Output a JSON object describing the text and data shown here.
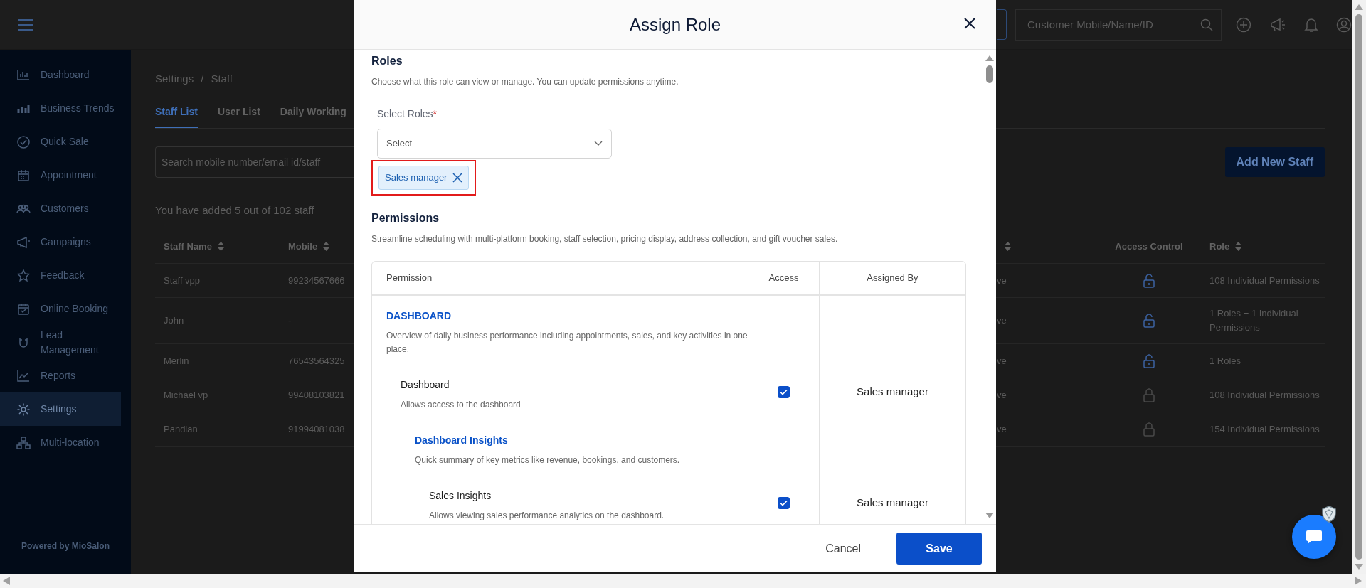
{
  "app_header": {
    "search_placeholder": "Customer Mobile/Name/ID"
  },
  "sidebar": {
    "items": [
      {
        "label": "Dashboard",
        "selected": false
      },
      {
        "label": "Business Trends",
        "selected": false
      },
      {
        "label": "Quick Sale",
        "selected": false
      },
      {
        "label": "Appointment",
        "selected": false
      },
      {
        "label": "Customers",
        "selected": false
      },
      {
        "label": "Campaigns",
        "selected": false
      },
      {
        "label": "Feedback",
        "selected": false
      },
      {
        "label": "Online Booking",
        "selected": false
      },
      {
        "label": "Lead Management",
        "selected": false
      },
      {
        "label": "Reports",
        "selected": false
      },
      {
        "label": "Settings",
        "selected": true
      },
      {
        "label": "Multi-location",
        "selected": false
      }
    ],
    "footer": "Powered by MioSalon"
  },
  "breadcrumb": {
    "items": [
      "Settings",
      "Staff"
    ],
    "separator": "/"
  },
  "tabs": [
    {
      "label": "Staff List",
      "selected": true
    },
    {
      "label": "User List",
      "selected": false
    },
    {
      "label": "Daily Working",
      "selected": false
    }
  ],
  "search": {
    "placeholder": "Search mobile number/email id/staff"
  },
  "add_button": "Add New Staff",
  "staff_summary": "You have added 5 out of 102 staff",
  "staff_table": {
    "columns": [
      {
        "label": "Staff Name",
        "sortable": true
      },
      {
        "label": "Mobile",
        "sortable": true
      },
      {
        "sortable": true
      },
      {
        "label": "Access Control",
        "sortable": false
      },
      {
        "label": "Role",
        "sortable": true
      }
    ],
    "rows": [
      {
        "staff_name": "Staff vpp",
        "mobile": "99234567666",
        "column_3": "ve",
        "access_enabled": true,
        "role": "108 Individual Permissions"
      },
      {
        "staff_name": "John",
        "mobile": "-",
        "column_3": "ve",
        "access_enabled": true,
        "role": "1 Roles + 1 Individual Permissions"
      },
      {
        "staff_name": "Merlin",
        "mobile": "76543564325",
        "column_3": "ve",
        "access_enabled": true,
        "role": "1 Roles"
      },
      {
        "staff_name": "Michael vp",
        "mobile": "99408103821",
        "column_3": "ve",
        "access_enabled": false,
        "role": "108 Individual Permissions"
      },
      {
        "staff_name": "Pandian",
        "mobile": "91994081038",
        "column_3": "ve",
        "access_enabled": false,
        "role": "154 Individual Permissions"
      }
    ]
  },
  "modal": {
    "title": "Assign Role",
    "roles": {
      "heading": "Roles",
      "description": "Choose what this role can view or manage. You can update permissions anytime.",
      "field_label": "Select Roles",
      "required_mark": "*",
      "placeholder": "Select",
      "chips": [
        {
          "label": "Sales manager",
          "highlighted": true
        }
      ]
    },
    "permissions": {
      "heading": "Permissions",
      "description": "Streamline scheduling with multi-platform booking, staff selection, pricing display, address collection, and gift voucher sales.",
      "columns": [
        "Permission",
        "Access",
        "Assigned By"
      ],
      "rows": [
        {
          "kind": "group",
          "title": "DASHBOARD",
          "description": "Overview of daily business performance including appointments, sales, and key activities in one place.",
          "children": [
            {
              "kind": "item",
              "title": "Dashboard",
              "description": "Allows access to the dashboard",
              "checked": true,
              "assigned_by": "Sales manager",
              "children": [
                {
                  "kind": "group",
                  "title": "Dashboard Insights",
                  "description": "Quick summary of key metrics like revenue, bookings, and customers.",
                  "children": [
                    {
                      "kind": "item",
                      "title": "Sales Insights",
                      "description": "Allows viewing sales performance analytics on the dashboard.",
                      "checked": true,
                      "assigned_by": "Sales manager"
                    }
                  ]
                }
              ]
            }
          ]
        }
      ]
    },
    "buttons": {
      "cancel": "Cancel",
      "save": "Save"
    }
  }
}
